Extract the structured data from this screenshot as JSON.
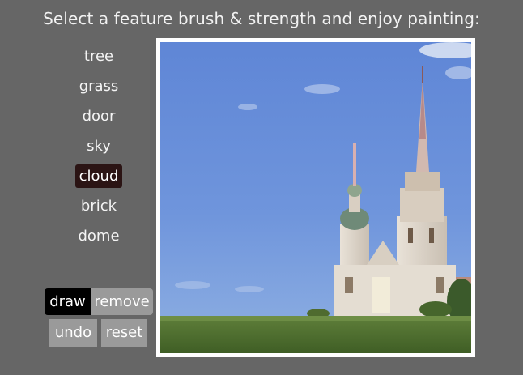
{
  "header": {
    "title": "Select a feature brush & strength and enjoy painting:"
  },
  "brushes": {
    "items": [
      {
        "label": "tree"
      },
      {
        "label": "grass"
      },
      {
        "label": "door"
      },
      {
        "label": "sky"
      },
      {
        "label": "cloud"
      },
      {
        "label": "brick"
      },
      {
        "label": "dome"
      }
    ],
    "selected": "cloud"
  },
  "controls": {
    "draw_label": "draw",
    "remove_label": "remove",
    "undo_label": "undo",
    "reset_label": "reset",
    "active_mode": "draw"
  },
  "colors": {
    "background": "#666666",
    "selected_brush": "#2b1414",
    "active_button": "#000000",
    "inactive_button": "#9a9a9a",
    "canvas_border": "#ffffff"
  }
}
